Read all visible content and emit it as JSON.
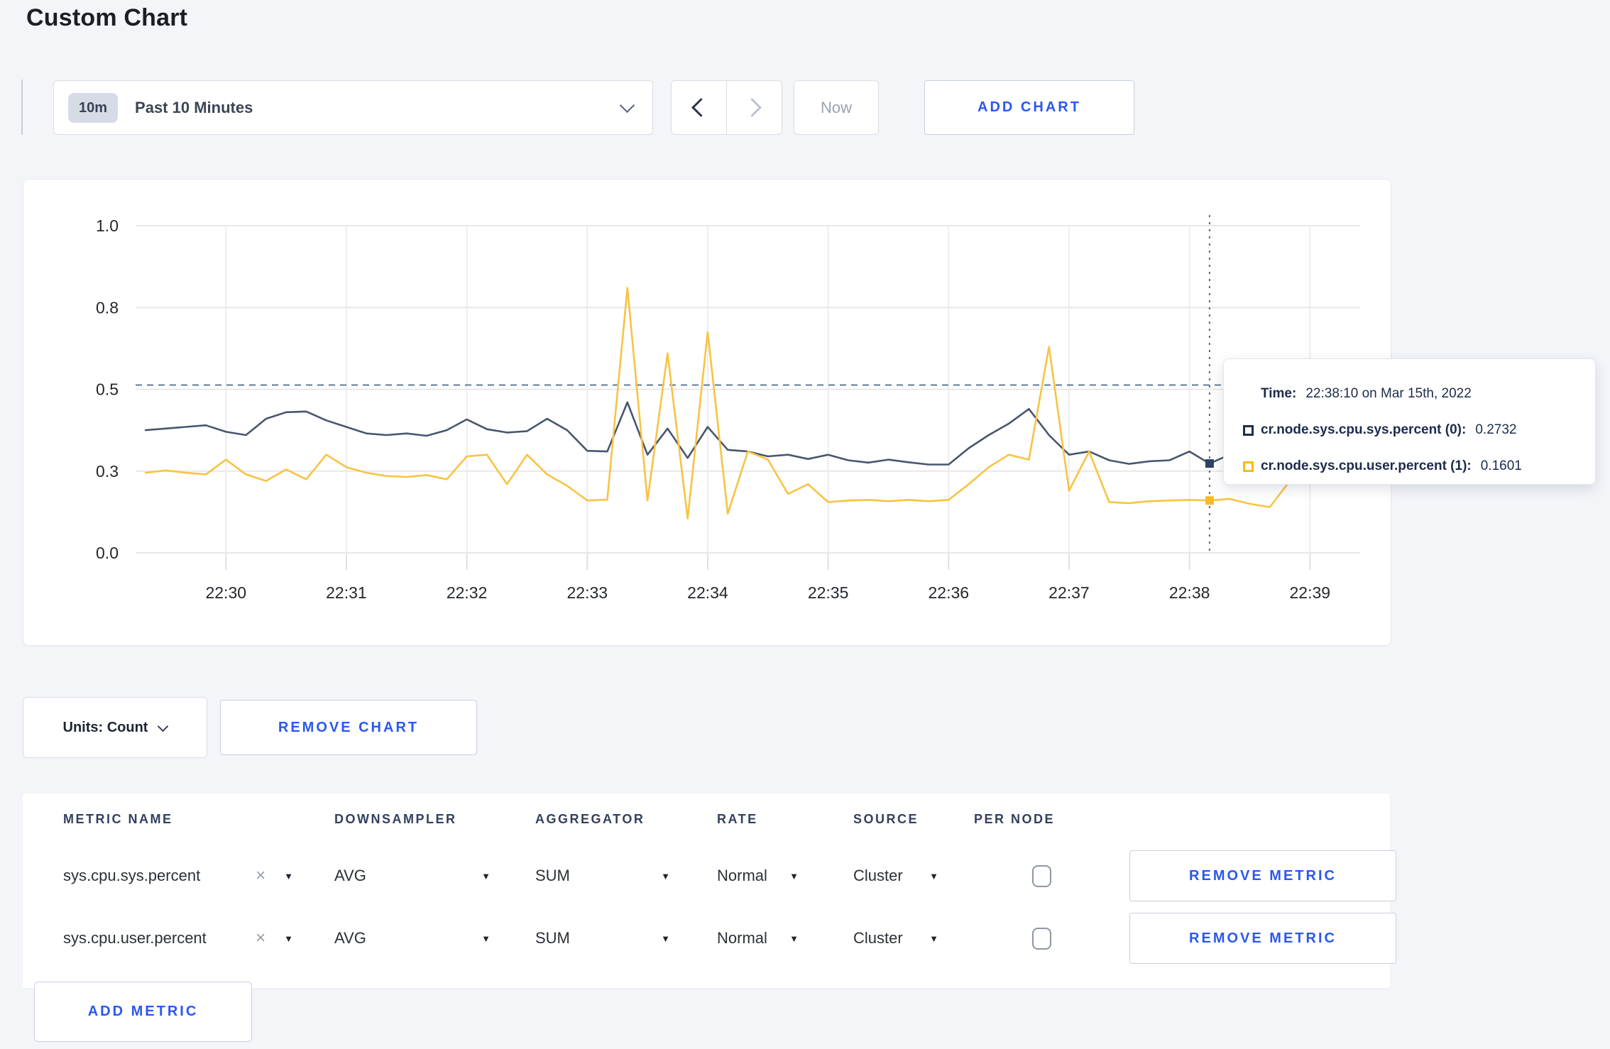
{
  "page": {
    "title": "Custom Chart"
  },
  "icons": {
    "close": "×",
    "caret_down": "▼"
  },
  "toolbar": {
    "time_range": {
      "badge": "10m",
      "label": "Past 10 Minutes"
    },
    "now_label": "Now",
    "add_chart_label": "ADD CHART"
  },
  "colors": {
    "accent_blue": "#2a58ef",
    "series_sys": "#48566f",
    "series_user": "#f8c344",
    "marker_sys": "#2e4265",
    "marker_user": "#f5bb27",
    "tooltip_text": "#1c2b4d",
    "crosshair": "#4f6a8f"
  },
  "chart_data": {
    "type": "line",
    "title": "",
    "xlabel": "",
    "ylabel": "",
    "grid": true,
    "legend_position": "tooltip",
    "y_domain": [
      0,
      1
    ],
    "y_ticks": [
      {
        "label": "1.0",
        "value": 1.0
      },
      {
        "label": "0.8",
        "value": 0.75
      },
      {
        "label": "0.5",
        "value": 0.5
      },
      {
        "label": "0.3",
        "value": 0.25
      },
      {
        "label": "0.0",
        "value": 0.0
      }
    ],
    "x_tick_labels": [
      "22:30",
      "22:31",
      "22:32",
      "22:33",
      "22:34",
      "22:35",
      "22:36",
      "22:37",
      "22:38",
      "22:39"
    ],
    "x_tick_seconds": [
      0,
      60,
      120,
      180,
      240,
      300,
      360,
      420,
      480,
      540
    ],
    "x_domain_seconds": [
      -45,
      565
    ],
    "threshold_value": 0.513,
    "crosshair_seconds": 490,
    "seconds": [
      -40,
      -30,
      -20,
      -10,
      0,
      10,
      20,
      30,
      40,
      50,
      60,
      70,
      80,
      90,
      100,
      110,
      120,
      130,
      140,
      150,
      160,
      170,
      180,
      190,
      200,
      210,
      220,
      230,
      240,
      250,
      260,
      270,
      280,
      290,
      300,
      310,
      320,
      330,
      340,
      350,
      360,
      370,
      380,
      390,
      400,
      410,
      420,
      430,
      440,
      450,
      460,
      470,
      480,
      490,
      500,
      510,
      520,
      530,
      540,
      550,
      560
    ],
    "series": [
      {
        "name": "cr.node.sys.cpu.sys.percent",
        "color": "#48566f",
        "marker_color": "#2e4265",
        "marker_value": 0.2732,
        "values": [
          0.375,
          0.38,
          0.385,
          0.39,
          0.37,
          0.36,
          0.41,
          0.43,
          0.432,
          0.405,
          0.385,
          0.365,
          0.36,
          0.365,
          0.358,
          0.375,
          0.408,
          0.378,
          0.368,
          0.372,
          0.41,
          0.375,
          0.312,
          0.31,
          0.46,
          0.3,
          0.38,
          0.29,
          0.385,
          0.315,
          0.31,
          0.295,
          0.3,
          0.287,
          0.3,
          0.283,
          0.276,
          0.285,
          0.277,
          0.27,
          0.27,
          0.32,
          0.36,
          0.395,
          0.44,
          0.36,
          0.3,
          0.31,
          0.283,
          0.272,
          0.28,
          0.283,
          0.31,
          0.2732,
          0.3,
          0.28,
          0.29,
          0.302,
          0.3,
          0.298,
          0.305
        ]
      },
      {
        "name": "cr.node.sys.cpu.user.percent",
        "color": "#f8c344",
        "marker_color": "#f5bb27",
        "marker_value": 0.1601,
        "values": [
          0.245,
          0.252,
          0.245,
          0.24,
          0.285,
          0.24,
          0.22,
          0.255,
          0.225,
          0.3,
          0.262,
          0.245,
          0.235,
          0.232,
          0.238,
          0.225,
          0.295,
          0.3,
          0.21,
          0.3,
          0.24,
          0.205,
          0.16,
          0.163,
          0.81,
          0.16,
          0.61,
          0.105,
          0.675,
          0.12,
          0.31,
          0.285,
          0.18,
          0.21,
          0.155,
          0.16,
          0.162,
          0.158,
          0.162,
          0.158,
          0.162,
          0.21,
          0.262,
          0.3,
          0.285,
          0.63,
          0.19,
          0.31,
          0.155,
          0.152,
          0.158,
          0.16,
          0.162,
          0.1601,
          0.165,
          0.15,
          0.14,
          0.22,
          0.3,
          0.23,
          0.27
        ]
      }
    ]
  },
  "tooltip": {
    "time_label": "Time:",
    "time_value": "22:38:10 on Mar 15th, 2022",
    "entries": [
      {
        "label": "cr.node.sys.cpu.sys.percent (0):",
        "value": "0.2732",
        "swatch_color": "#1e2c50"
      },
      {
        "label": "cr.node.sys.cpu.user.percent (1):",
        "value": "0.1601",
        "swatch_color": "#f7bd13"
      }
    ]
  },
  "chart_controls": {
    "units_label": "Units: Count",
    "remove_chart_label": "REMOVE CHART"
  },
  "metrics_table": {
    "headers": [
      "METRIC NAME",
      "DOWNSAMPLER",
      "AGGREGATOR",
      "RATE",
      "SOURCE",
      "PER NODE"
    ],
    "rows": [
      {
        "metric": "sys.cpu.sys.percent",
        "downsampler": "AVG",
        "aggregator": "SUM",
        "rate": "Normal",
        "source": "Cluster",
        "per_node_checked": false,
        "remove_label": "REMOVE METRIC"
      },
      {
        "metric": "sys.cpu.user.percent",
        "downsampler": "AVG",
        "aggregator": "SUM",
        "rate": "Normal",
        "source": "Cluster",
        "per_node_checked": false,
        "remove_label": "REMOVE METRIC"
      }
    ],
    "add_metric_label": "ADD METRIC"
  }
}
